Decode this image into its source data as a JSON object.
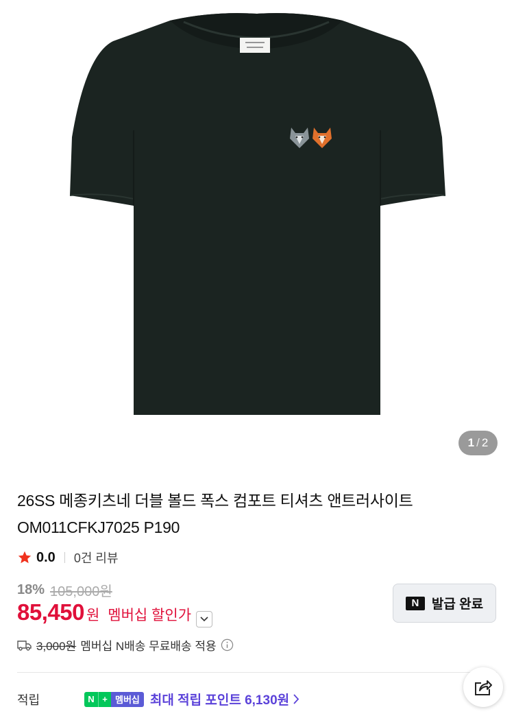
{
  "gallery": {
    "current": "1",
    "separator": "/",
    "total": "2"
  },
  "product": {
    "title": "26SS 메종키츠네 더블 볼드 폭스 컴포트 티셔츠 앤트러사이트 OM011CFKJ7025 P190",
    "rating": "0.0",
    "review_count": "0건 리뷰",
    "discount_pct": "18%",
    "original_price": "105,000원",
    "price": "85,450",
    "price_unit": "원",
    "member_discount_label": "멤버십 할인가",
    "coupon_button": "발급 완료",
    "coupon_badge": "N",
    "shipping_fee": "3,000원",
    "shipping_note": "멤버십 N배송 무료배송 적용",
    "points_label": "적립",
    "np_n": "N",
    "np_plus": "+",
    "np_member": "멤버십",
    "points_text": "최대 적립 포인트 6,130원"
  },
  "colors": {
    "price_red": "#e0103a",
    "points_purple": "#5b42d9",
    "naver_green": "#03c75a",
    "shirt": "#1b2421"
  },
  "icons": [
    "star-icon",
    "chevron-down-icon",
    "truck-icon",
    "info-icon",
    "chevron-right-icon",
    "share-icon"
  ]
}
